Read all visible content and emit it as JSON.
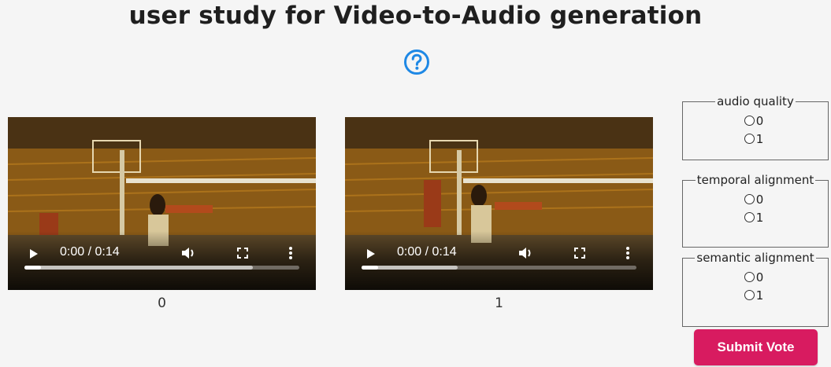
{
  "page": {
    "title": "user study for Video-to-Audio generation",
    "help_icon": "question-circle-icon"
  },
  "videos": [
    {
      "caption": "0",
      "time": "0:00 / 0:14",
      "buffered_fraction": 0.83,
      "played_fraction": 0.06
    },
    {
      "caption": "1",
      "time": "0:00 / 0:14",
      "buffered_fraction": 0.35,
      "played_fraction": 0.06
    }
  ],
  "questions": [
    {
      "legend": "audio quality",
      "options": [
        "0",
        "1"
      ]
    },
    {
      "legend": "temporal alignment",
      "options": [
        "0",
        "1"
      ]
    },
    {
      "legend": "semantic alignment",
      "options": [
        "0",
        "1"
      ]
    }
  ],
  "submit": {
    "label": "Submit Vote"
  },
  "colors": {
    "accent": "#d81b60",
    "help_icon": "#1e88e5",
    "background": "#f5f5f5"
  }
}
